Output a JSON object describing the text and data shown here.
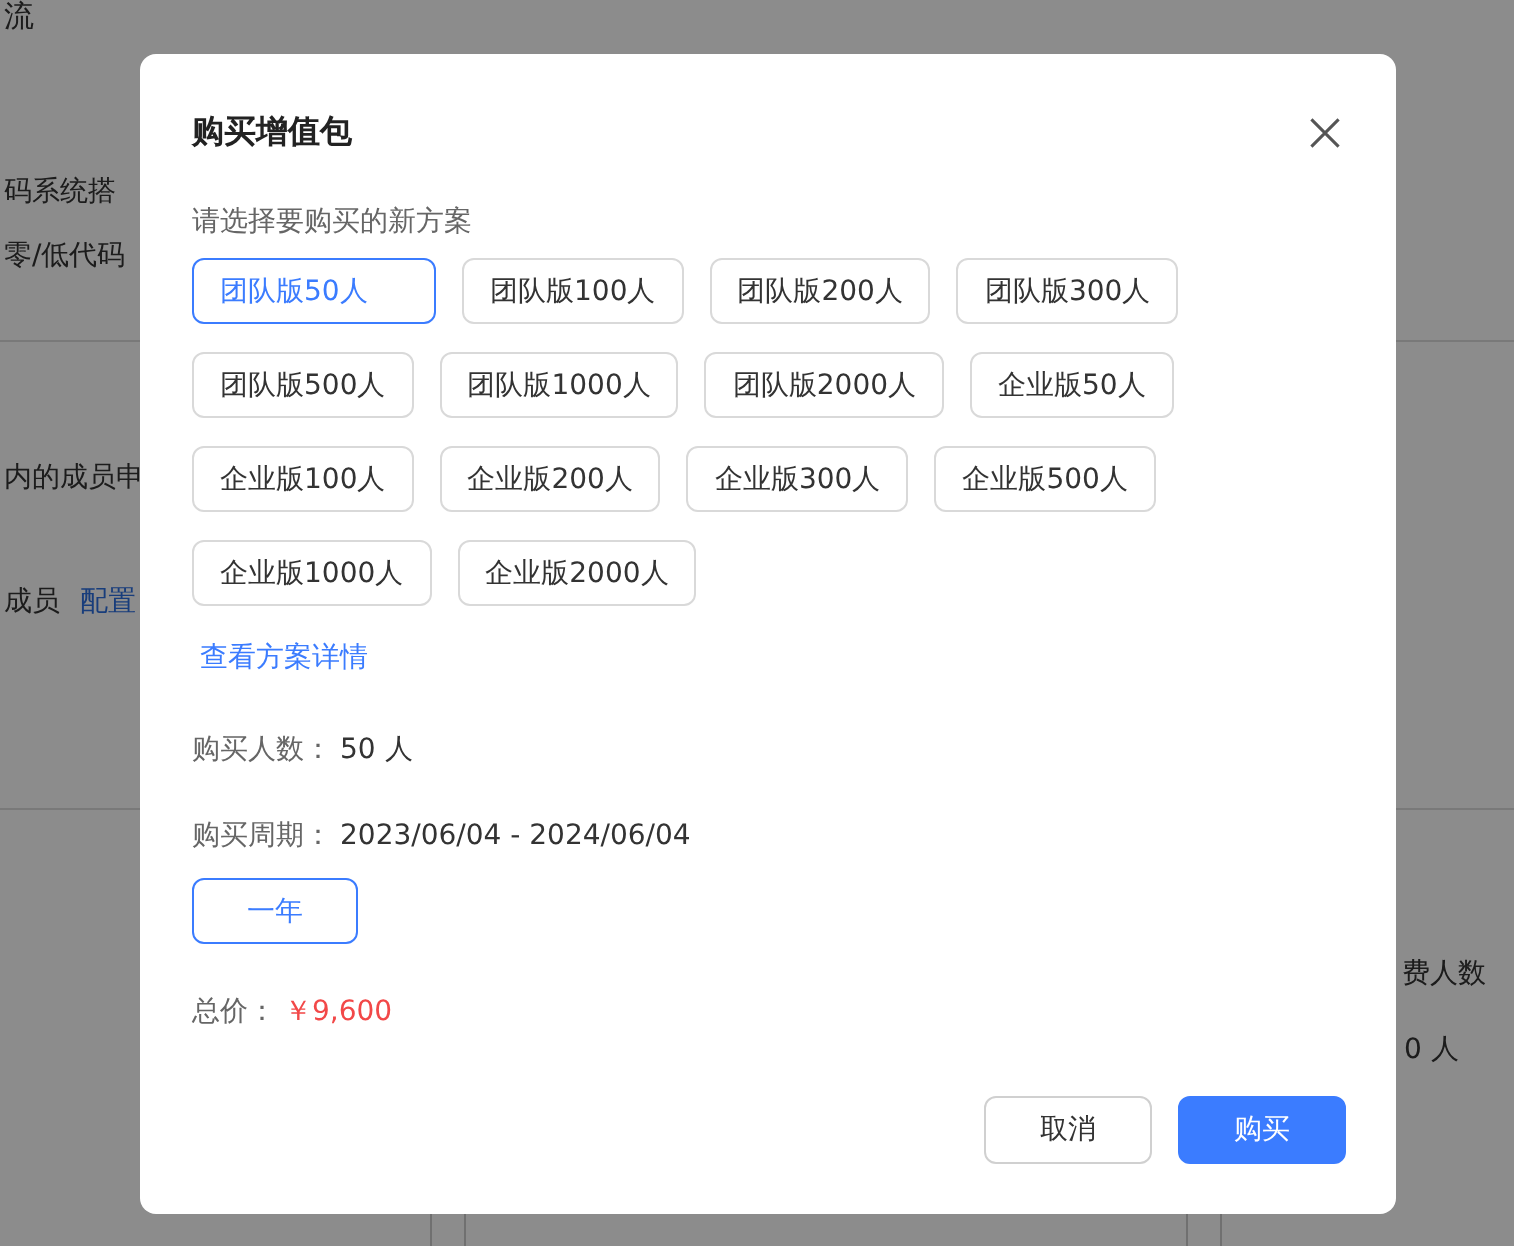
{
  "background_page": {
    "header_title": "流",
    "section_1": {
      "lines": [
        "码系统搭",
        "零/低代码"
      ]
    },
    "section_2": {
      "lines": [
        "内的成员申"
      ],
      "members_label": "成员",
      "config_link": "配置"
    },
    "side_card": {
      "label": "费人数",
      "value": "0 人"
    }
  },
  "dialog": {
    "title": "购买增值包",
    "prompt": "请选择要购买的新方案",
    "plans": [
      {
        "label": "团队版50人",
        "selected": true
      },
      {
        "label": "团队版100人",
        "selected": false
      },
      {
        "label": "团队版200人",
        "selected": false
      },
      {
        "label": "团队版300人",
        "selected": false
      },
      {
        "label": "团队版500人",
        "selected": false
      },
      {
        "label": "团队版1000人",
        "selected": false
      },
      {
        "label": "团队版2000人",
        "selected": false
      },
      {
        "label": "企业版50人",
        "selected": false
      },
      {
        "label": "企业版100人",
        "selected": false
      },
      {
        "label": "企业版200人",
        "selected": false
      },
      {
        "label": "企业版300人",
        "selected": false
      },
      {
        "label": "企业版500人",
        "selected": false
      },
      {
        "label": "企业版1000人",
        "selected": false
      },
      {
        "label": "企业版2000人",
        "selected": false
      }
    ],
    "details_link": "查看方案详情",
    "headcount": {
      "label": "购买人数：",
      "value": "50 人"
    },
    "period": {
      "label": "购买周期：",
      "value": "2023/06/04 - 2024/06/04"
    },
    "durations": [
      {
        "label": "一年",
        "selected": true
      }
    ],
    "total": {
      "label": "总价：",
      "value": "￥9,600"
    },
    "buttons": [
      {
        "label": "取消",
        "kind": "secondary"
      },
      {
        "label": "购买",
        "kind": "primary"
      }
    ]
  }
}
